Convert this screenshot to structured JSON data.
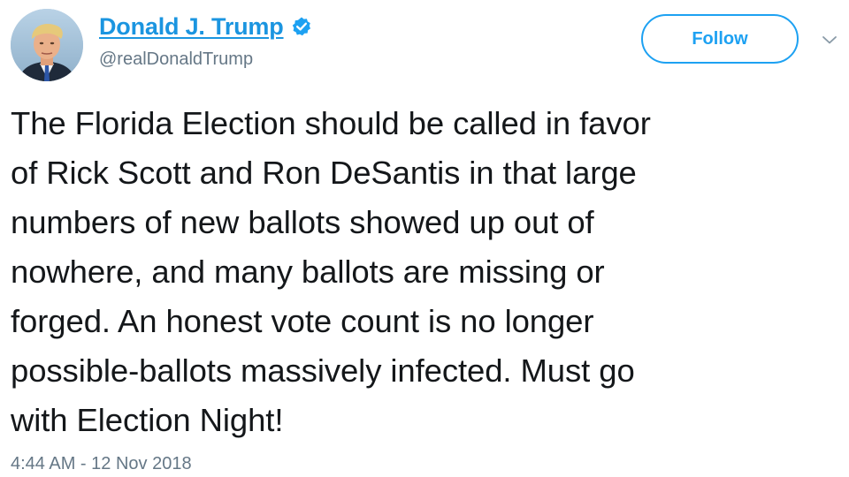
{
  "tweet": {
    "author": {
      "display_name": "Donald J. Trump",
      "handle": "@realDonaldTrump",
      "verified": true,
      "avatar_icon": "profile-avatar"
    },
    "follow_label": "Follow",
    "menu_icon": "chevron-down-icon",
    "text": "The Florida Election should be called in favor\nof Rick Scott and Ron DeSantis in that large\nnumbers of new ballots showed up out of\nnowhere, and many ballots are missing or\nforged. An honest vote count is no longer\npossible-ballots massively infected. Must go\nwith Election Night!",
    "timestamp": "4:44 AM - 12 Nov 2018"
  },
  "colors": {
    "link_blue": "#1b95e0",
    "follow_blue": "#1da1f2",
    "secondary_text": "#657786",
    "body_text": "#14171a"
  }
}
